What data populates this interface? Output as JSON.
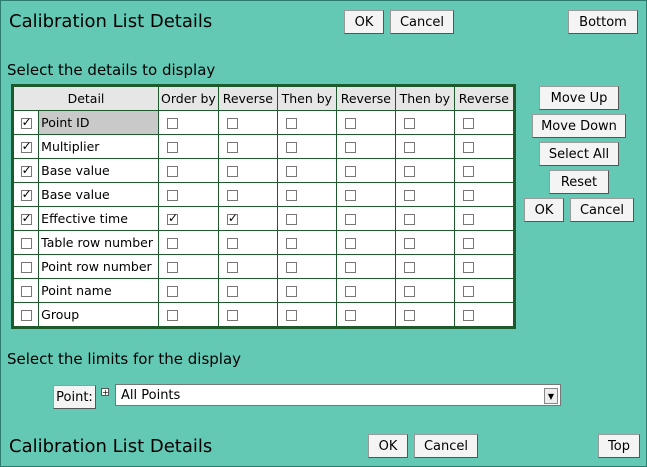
{
  "header": {
    "title": "Calibration List Details",
    "ok_label": "OK",
    "cancel_label": "Cancel",
    "bottom_label": "Bottom"
  },
  "details_section": {
    "label": "Select the details to display",
    "columns": [
      "Detail",
      "Order by",
      "Reverse",
      "Then by",
      "Reverse",
      "Then by",
      "Reverse"
    ],
    "rows": [
      {
        "detail": "Point ID",
        "show": true,
        "selected": true,
        "opts": [
          false,
          false,
          false,
          false,
          false,
          false
        ]
      },
      {
        "detail": "Multiplier",
        "show": true,
        "selected": false,
        "opts": [
          false,
          false,
          false,
          false,
          false,
          false
        ]
      },
      {
        "detail": "Base value",
        "show": true,
        "selected": false,
        "opts": [
          false,
          false,
          false,
          false,
          false,
          false
        ]
      },
      {
        "detail": "Base value",
        "show": true,
        "selected": false,
        "opts": [
          false,
          false,
          false,
          false,
          false,
          false
        ]
      },
      {
        "detail": "Effective time",
        "show": true,
        "selected": false,
        "opts": [
          true,
          true,
          false,
          false,
          false,
          false
        ]
      },
      {
        "detail": "Table row number",
        "show": false,
        "selected": false,
        "opts": [
          false,
          false,
          false,
          false,
          false,
          false
        ]
      },
      {
        "detail": "Point row number",
        "show": false,
        "selected": false,
        "opts": [
          false,
          false,
          false,
          false,
          false,
          false
        ]
      },
      {
        "detail": "Point name",
        "show": false,
        "selected": false,
        "opts": [
          false,
          false,
          false,
          false,
          false,
          false
        ]
      },
      {
        "detail": "Group",
        "show": false,
        "selected": false,
        "opts": [
          false,
          false,
          false,
          false,
          false,
          false
        ]
      }
    ]
  },
  "side_buttons": {
    "move_up": "Move Up",
    "move_down": "Move Down",
    "select_all": "Select All",
    "reset": "Reset",
    "ok": "OK",
    "cancel": "Cancel"
  },
  "limits_section": {
    "label": "Select the limits for the display",
    "point_button": "Point:",
    "point_select_value": "All Points"
  },
  "footer": {
    "title": "Calibration List Details",
    "ok_label": "OK",
    "cancel_label": "Cancel",
    "top_label": "Top"
  }
}
